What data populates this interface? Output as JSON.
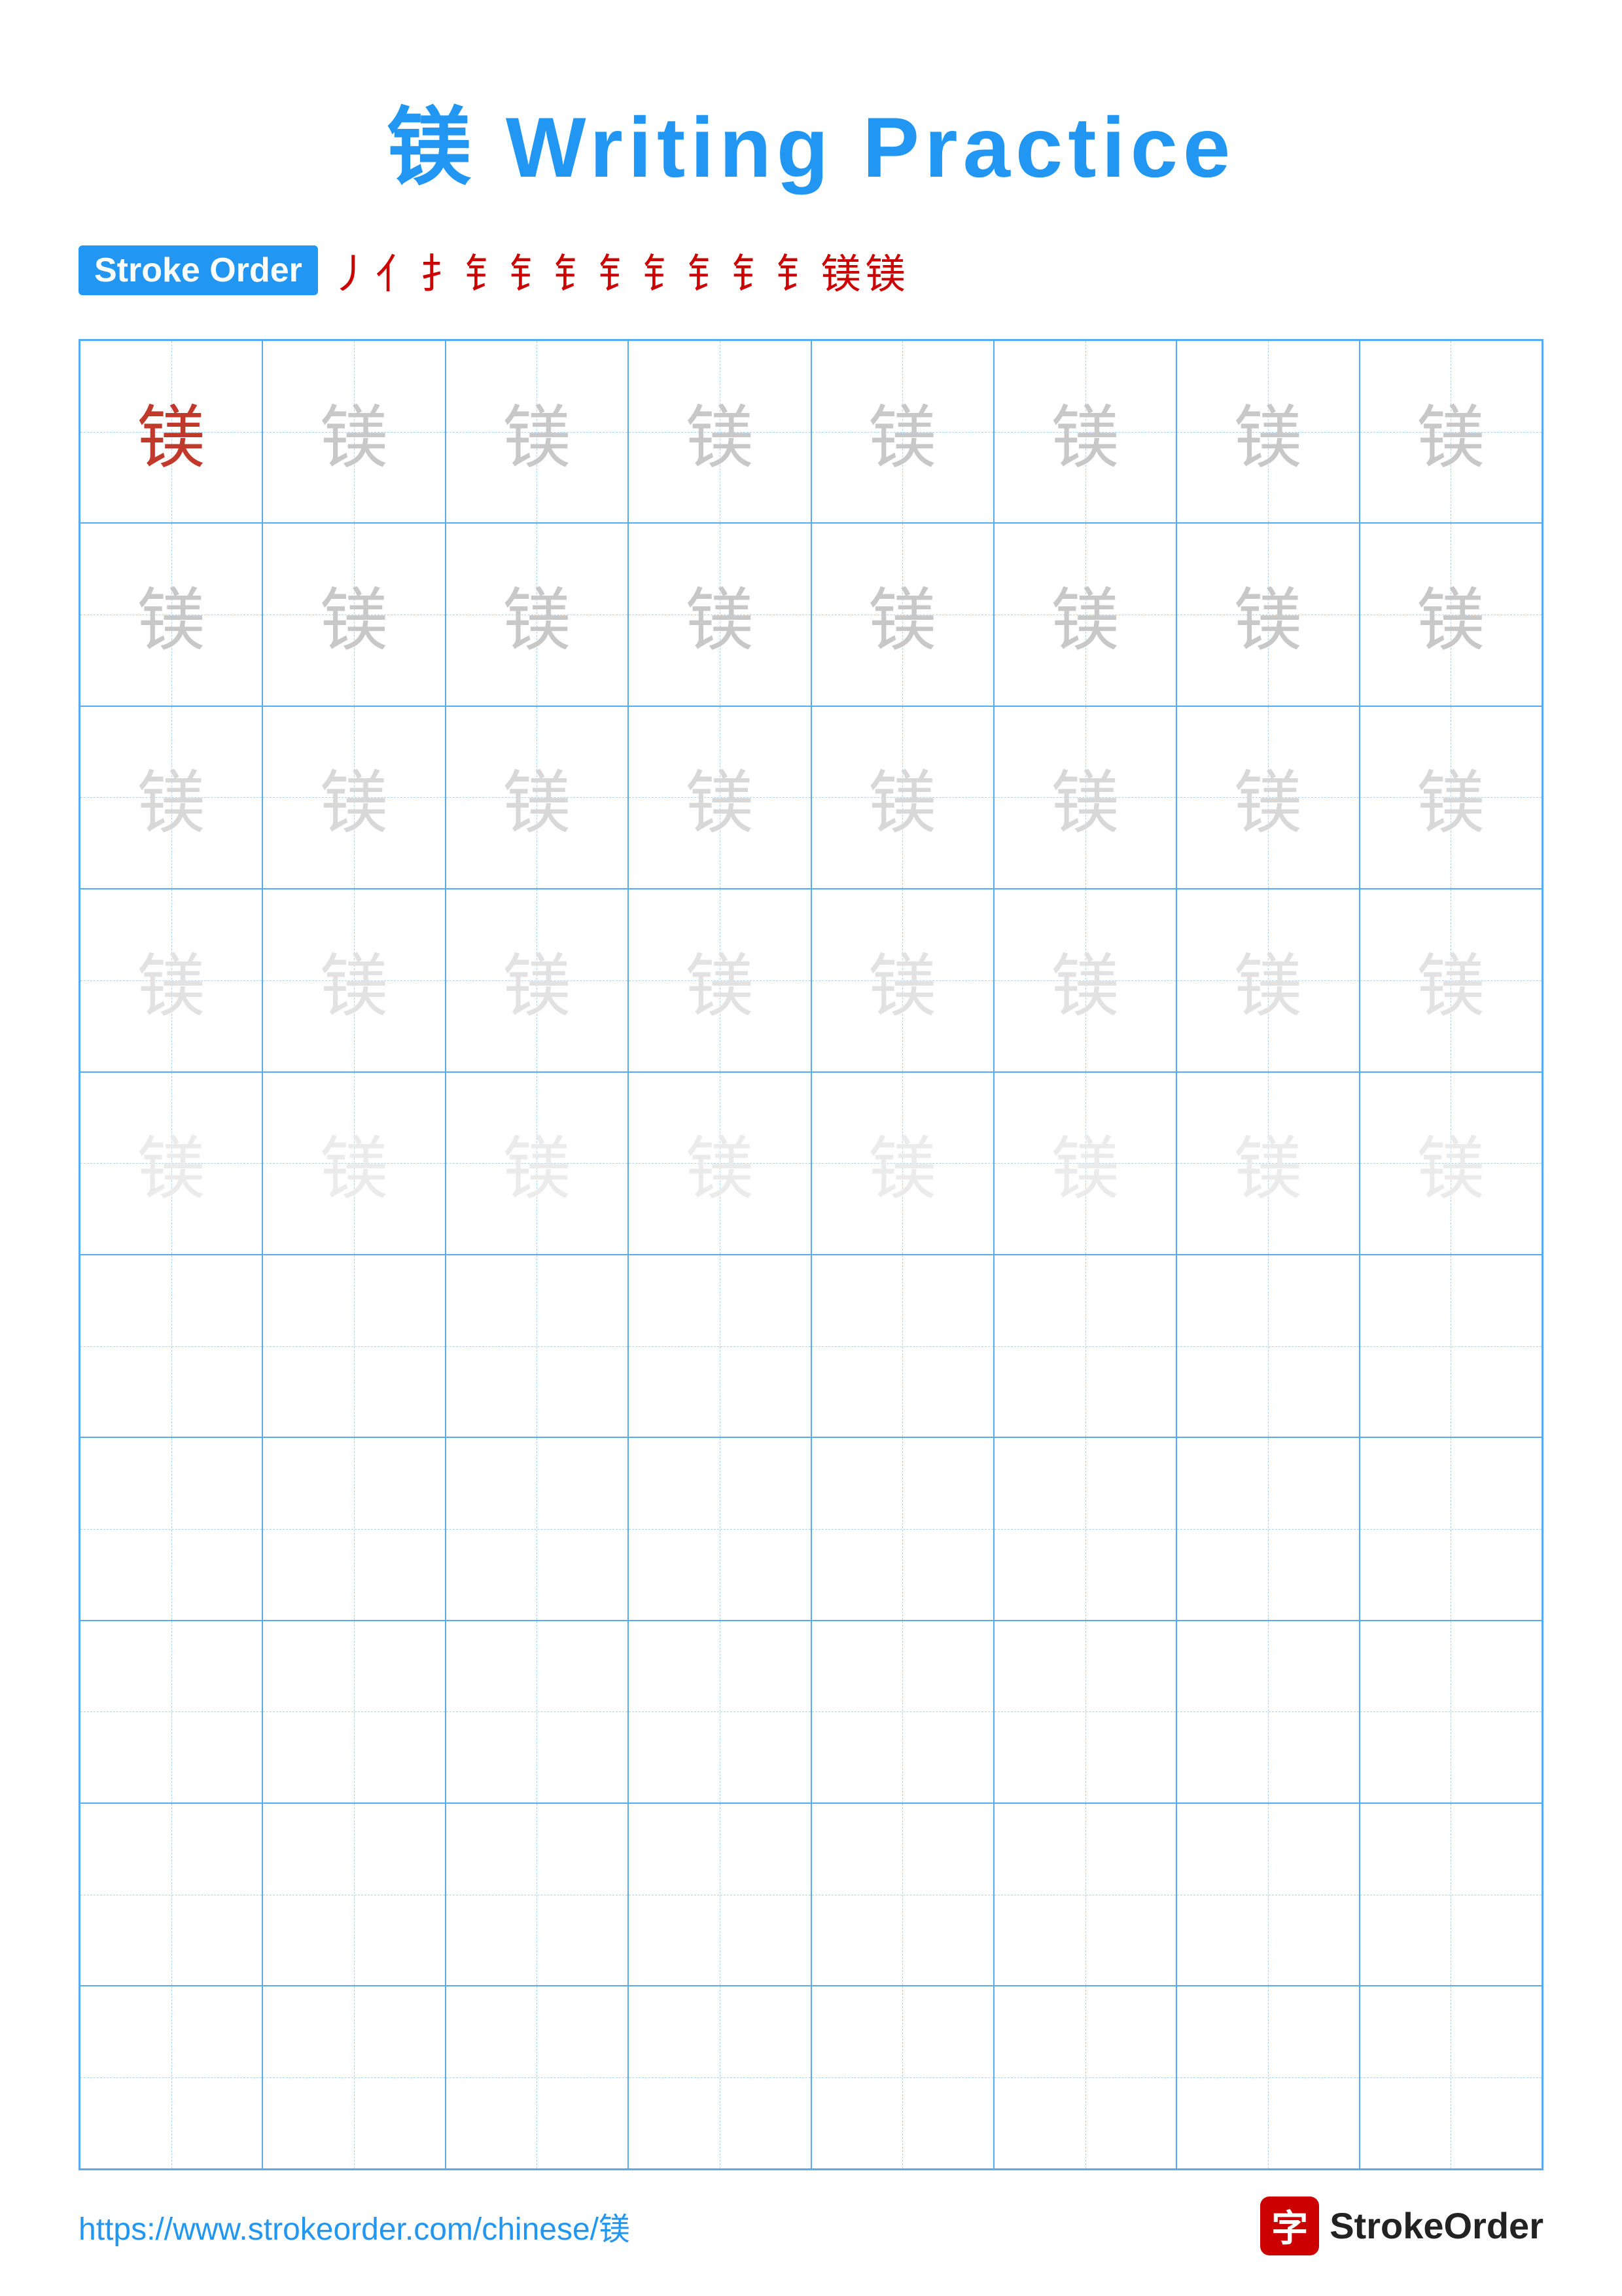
{
  "title": {
    "char": "镁",
    "text": " Writing Practice"
  },
  "stroke_order": {
    "badge_label": "Stroke Order",
    "strokes": [
      "丿",
      "亻",
      "扌",
      "钅",
      "钅",
      "钅",
      "钅",
      "钅",
      "钅",
      "钅",
      "钅",
      "镁",
      "镁"
    ]
  },
  "grid": {
    "rows": 10,
    "cols": 8,
    "char": "镁",
    "filled_rows": 5
  },
  "footer": {
    "url": "https://www.strokeorder.com/chinese/镁",
    "logo_char": "字",
    "logo_text": "StrokeOrder"
  }
}
